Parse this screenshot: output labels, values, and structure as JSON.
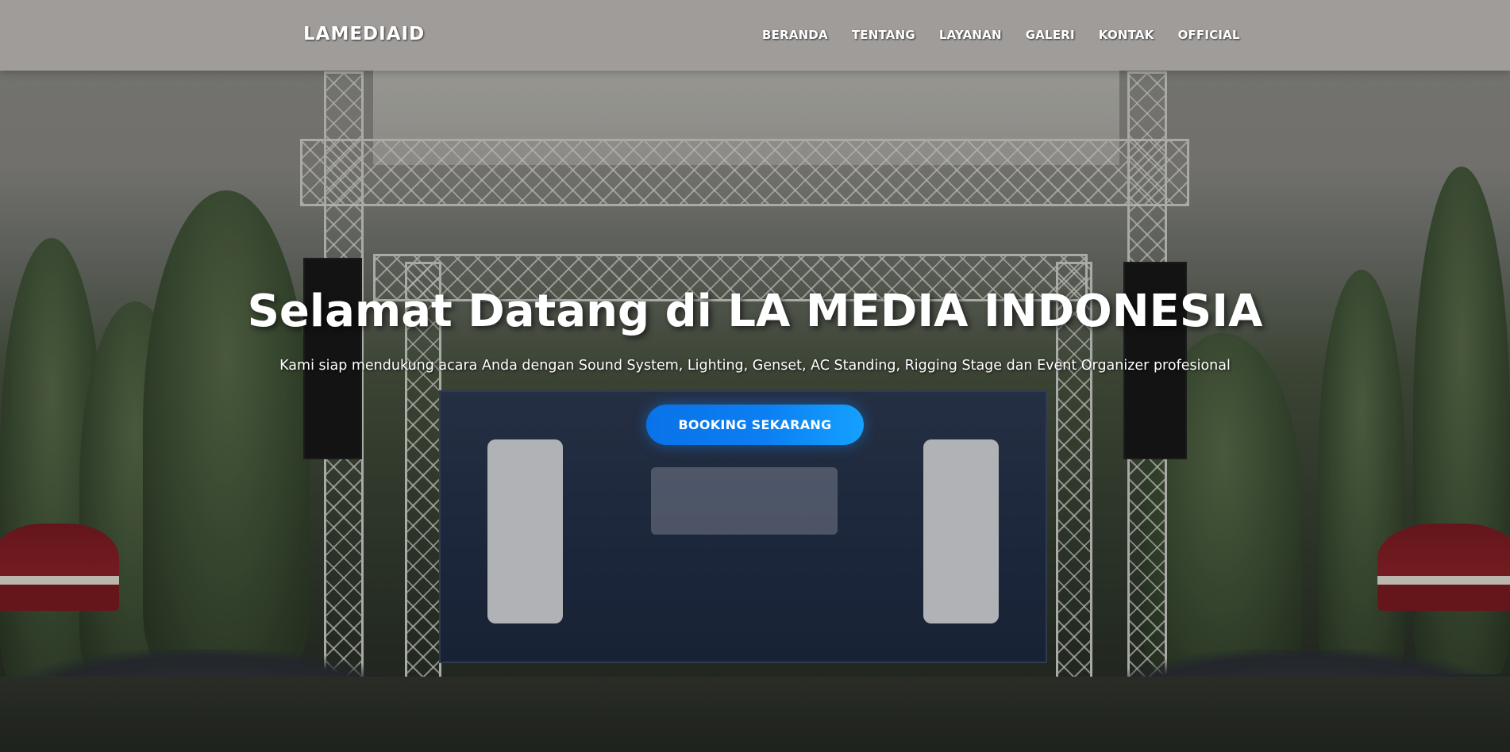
{
  "navbar": {
    "brand": "LAMEDIAID",
    "links": [
      "BERANDA",
      "TENTANG",
      "LAYANAN",
      "GALERI",
      "KONTAK",
      "OFFICIAL"
    ]
  },
  "hero": {
    "title": "Selamat Datang di LA MEDIA INDONESIA",
    "subtitle": "Kami siap mendukung acara Anda dengan Sound System, Lighting, Genset, AC Standing, Rigging Stage dan Event Organizer profesional",
    "cta_label": "BOOKING SEKARANG"
  },
  "colors": {
    "navbar_bg": "#aaa6a2",
    "cta_start": "#0a72e8",
    "cta_end": "#14a1ff",
    "text": "#ffffff"
  },
  "background_image": {
    "description_icon": "outdoor-stage-photo"
  }
}
